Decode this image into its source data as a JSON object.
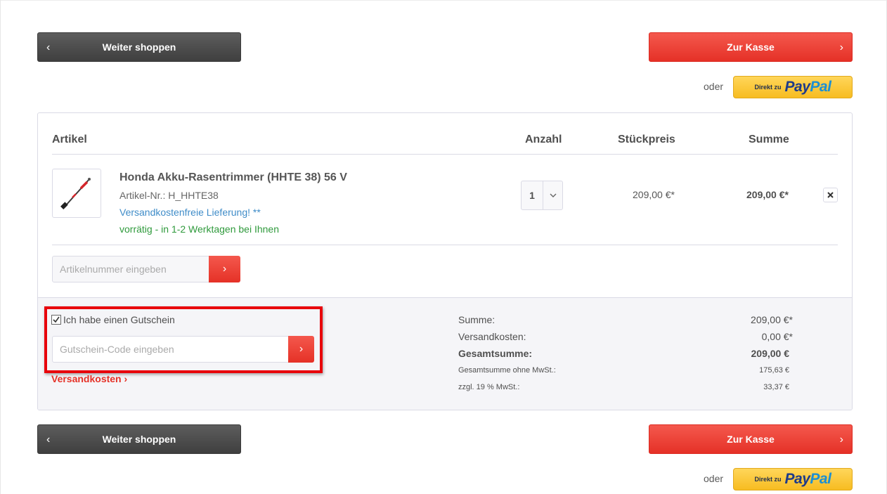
{
  "actions": {
    "continue_label": "Weiter shoppen",
    "checkout_label": "Zur Kasse",
    "or_label": "oder",
    "paypal_prefix": "Direkt zu",
    "paypal_brand_1": "Pay",
    "paypal_brand_2": "Pal"
  },
  "table_headers": {
    "article": "Artikel",
    "quantity": "Anzahl",
    "unit_price": "Stückpreis",
    "sum": "Summe"
  },
  "item": {
    "name": "Honda Akku-Rasentrimmer (HHTE 38) 56 V",
    "article_no": "Artikel-Nr.: H_HHTE38",
    "shipping_note": "Versandkostenfreie Lieferung! **",
    "stock": "vorrätig - in 1-2 Werktagen bei Ihnen",
    "quantity": "1",
    "unit_price": "209,00 €*",
    "total": "209,00 €*"
  },
  "article_input": {
    "placeholder": "Artikelnummer eingeben"
  },
  "voucher": {
    "checkbox_label": "Ich habe einen Gutschein",
    "checked": true,
    "placeholder": "Gutschein-Code eingeben"
  },
  "shipping_link": "Versandkosten",
  "summary": [
    {
      "label": "Summe:",
      "value": "209,00 €*"
    },
    {
      "label": "Versandkosten:",
      "value": "0,00 €*"
    },
    {
      "label": "Gesamtsumme:",
      "value": "209,00 €"
    },
    {
      "label": "Gesamtsumme ohne MwSt.:",
      "value": "175,63 €"
    },
    {
      "label": "zzgl. 19 % MwSt.:",
      "value": "33,37 €"
    }
  ],
  "colors": {
    "accent_red": "#e53127",
    "dark_button": "#4a4a4a",
    "paypal_yellow": "#f9c133",
    "link_blue": "#3f8cc8",
    "stock_green": "#2f9a3c",
    "highlight_red": "#e8000b"
  }
}
